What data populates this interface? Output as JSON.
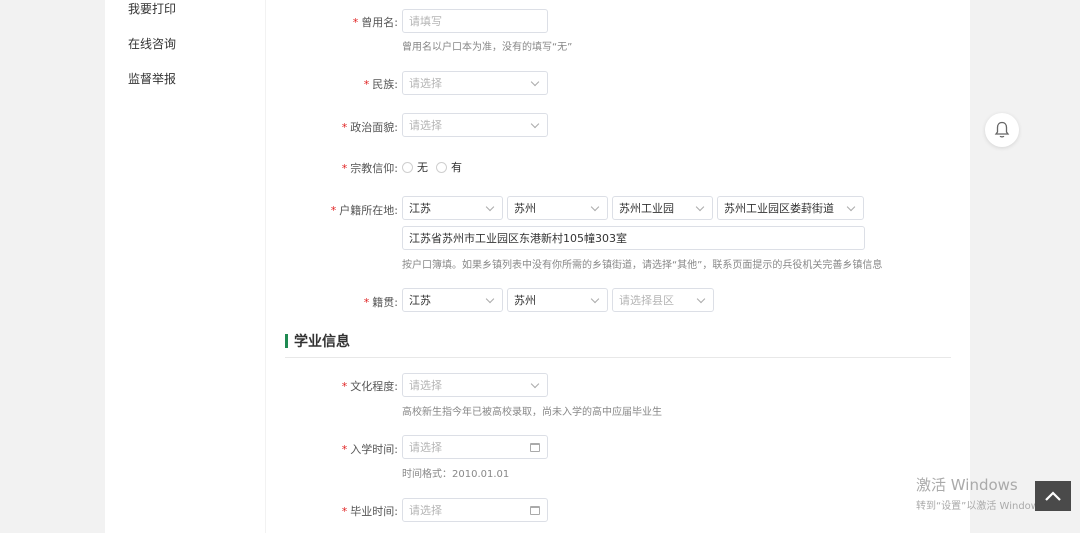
{
  "sidebar": {
    "items": [
      {
        "label": "我要打印"
      },
      {
        "label": "在线咨询"
      },
      {
        "label": "监督举报"
      }
    ]
  },
  "form": {
    "required_mark": "*",
    "former_name": {
      "label": "曾用名:",
      "placeholder": "请填写",
      "hint": "曾用名以户口本为准，没有的填写“无”"
    },
    "ethnicity": {
      "label": "民族:",
      "placeholder": "请选择"
    },
    "political_status": {
      "label": "政治面貌:",
      "placeholder": "请选择"
    },
    "religion": {
      "label": "宗教信仰:",
      "options": [
        {
          "label": "无"
        },
        {
          "label": "有"
        }
      ]
    },
    "household": {
      "label": "户籍所在地:",
      "province": "江苏",
      "city": "苏州",
      "district": "苏州工业园",
      "street": "苏州工业园区娄葑街道",
      "address": "江苏省苏州市工业园区东港新村105幢303室",
      "hint": "按户口簿填。如果乡镇列表中没有你所需的乡镇街道，请选择“其他”，联系页面提示的兵役机关完善乡镇信息"
    },
    "native_place": {
      "label": "籍贯:",
      "province": "江苏",
      "city": "苏州",
      "district_placeholder": "请选择县区"
    },
    "section_title": "学业信息",
    "education": {
      "label": "文化程度:",
      "placeholder": "请选择",
      "hint": "高校新生指今年已被高校录取，尚未入学的高中应届毕业生"
    },
    "enroll_date": {
      "label": "入学时间:",
      "placeholder": "请选择",
      "hint": "时间格式：2010.01.01"
    },
    "graduate_date": {
      "label": "毕业时间:",
      "placeholder": "请选择"
    }
  },
  "watermark": {
    "line1": "激活 Windows",
    "line2": "转到“设置”以激活 Windows。"
  },
  "icons": {
    "bell": "bell-icon",
    "back_to_top": "arrow-up-icon"
  },
  "colors": {
    "accent": "#1f8a52",
    "required": "#e02020"
  }
}
